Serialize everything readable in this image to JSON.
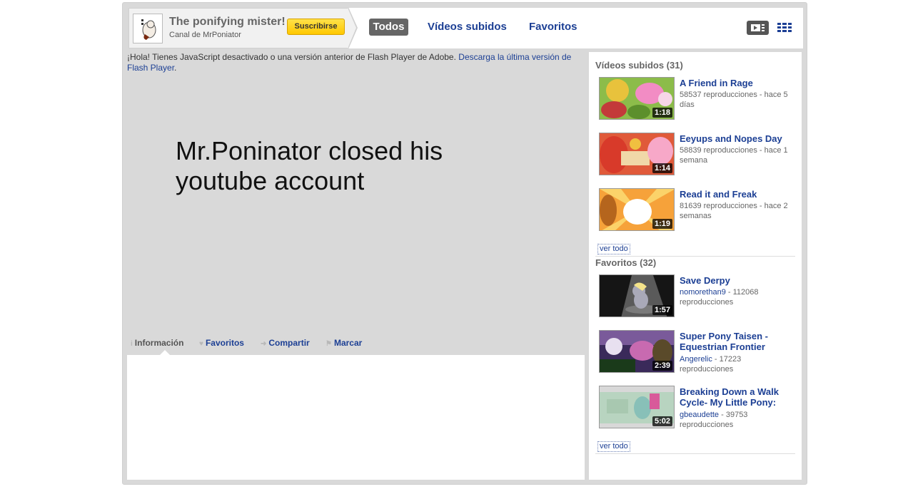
{
  "channel": {
    "title": "The ponifying mister!",
    "subtitle": "Canal de MrPoniator",
    "subscribe_label": "Suscribirse"
  },
  "nav": {
    "tabs": [
      {
        "label": "Todos",
        "active": true
      },
      {
        "label": "Vídeos subidos",
        "active": false
      },
      {
        "label": "Favoritos",
        "active": false
      }
    ]
  },
  "view_toggles": [
    "player-view-icon",
    "grid-view-icon"
  ],
  "player": {
    "flash_message": "¡Hola! Tienes JavaScript desactivado o una versión anterior de Flash Player de Adobe.",
    "flash_link": "Descarga la última versión de Flash Player",
    "overlay_text": "Mr.Poninator closed his youtube account"
  },
  "info_tabs": [
    {
      "label": "Información",
      "icon": "info-icon"
    },
    {
      "label": "Favoritos",
      "icon": "heart-icon"
    },
    {
      "label": "Compartir",
      "icon": "share-arrow-icon"
    },
    {
      "label": "Marcar",
      "icon": "flag-icon"
    }
  ],
  "sidebar": {
    "uploads": {
      "title": "Vídeos subidos (31)",
      "see_all": "ver todo",
      "videos": [
        {
          "title": "A Friend in Rage",
          "meta": "58537 reproducciones - hace 5 días",
          "duration": "1:18"
        },
        {
          "title": "Eeyups and Nopes Day",
          "meta": "58839 reproducciones - hace 1 semana",
          "duration": "1:14"
        },
        {
          "title": "Read it and Freak",
          "meta": "81639 reproducciones - hace 2 semanas",
          "duration": "1:19"
        }
      ]
    },
    "favorites": {
      "title": "Favoritos (32)",
      "see_all": "ver todo",
      "videos": [
        {
          "title": "Save Derpy",
          "author": "nomorethan9",
          "meta": " - 112068 reproducciones",
          "duration": "1:57"
        },
        {
          "title": "Super Pony Taisen - Equestrian Frontier",
          "author": "Angerelic",
          "meta": " - 17223 reproducciones",
          "duration": "2:39"
        },
        {
          "title": "Breaking Down a Walk Cycle- My Little Pony:",
          "author": "gbeaudette",
          "meta": " - 39753 reproducciones",
          "duration": "5:02"
        }
      ]
    }
  },
  "colors": {
    "frame_bg": "#d9d9d9",
    "link": "#1c3f94",
    "active_tab": "#666666",
    "subscribe": "#ffd21f"
  }
}
